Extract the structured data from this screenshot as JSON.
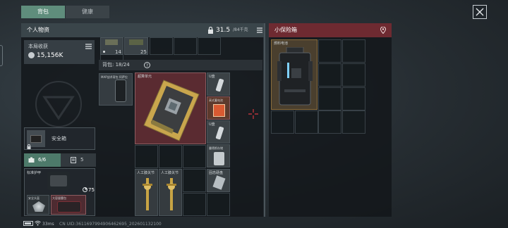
{
  "tabs": [
    {
      "label": "背包"
    },
    {
      "label": "健康"
    }
  ],
  "personal": {
    "title": "个人物资",
    "weight": "31.5",
    "weight_max": "/84千克",
    "income_label": "本局收获",
    "income_value": "15,156K",
    "safe_box_label": "安全箱",
    "armor_count": "6/6",
    "rig_count": "5",
    "armor_label": "标准护甲",
    "armor_value": "75",
    "helmet_label": "安全头盔",
    "bag_label": "大容量腰包"
  },
  "backpack": {
    "label": "背包: 18/24",
    "top_items": [
      {
        "count": "14"
      },
      {
        "count": "25"
      }
    ],
    "items": {
      "map": "MAP战术背包 阿萨拉",
      "board": "超算单元",
      "usb1": "U盘",
      "battery": "高式蓄电池",
      "usb2": "U盘",
      "hdd": "曼德斯存储",
      "joint1": "人工膝关节",
      "joint2": "人工膝关节",
      "ssd": "固态硬盘"
    }
  },
  "safe_box": {
    "title": "小保险箱",
    "item_label": "燃料电池"
  },
  "status": {
    "ping": "33ms",
    "uid": "CN UID:3611697994906462695_202601132100"
  },
  "colors": {
    "accent_green": "#5f8d7c",
    "safe_red": "#6e2a31",
    "highlight_red": "#5a2b31"
  }
}
